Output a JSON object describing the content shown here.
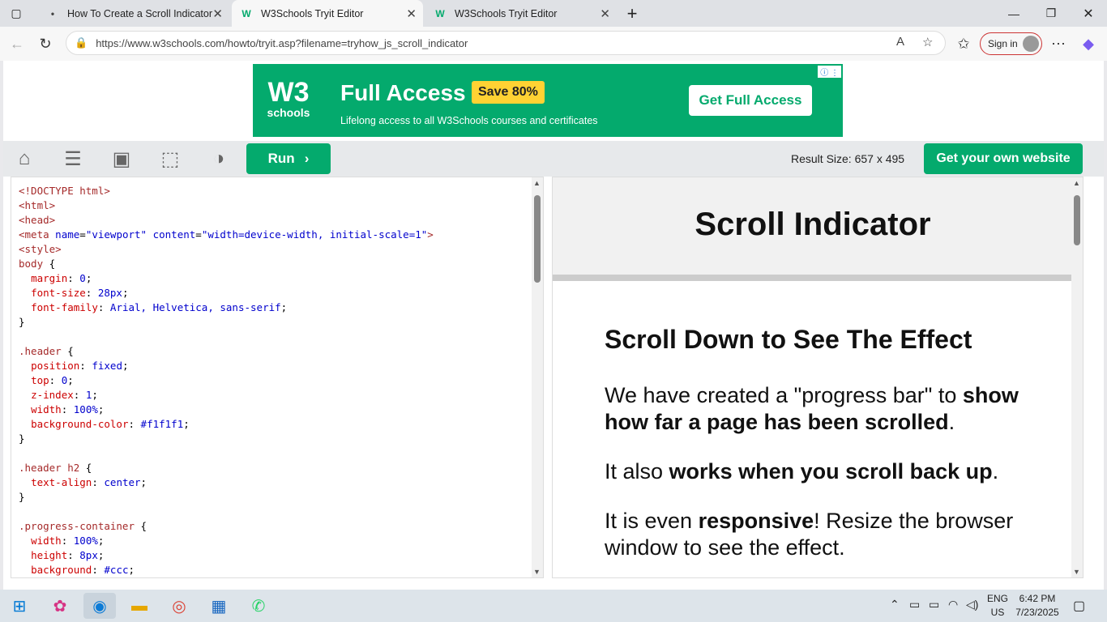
{
  "browser": {
    "tabs": [
      {
        "title": "How To Create a Scroll Indicator"
      },
      {
        "title": "W3Schools Tryit Editor"
      },
      {
        "title": "W3Schools Tryit Editor"
      }
    ],
    "url": "https://www.w3schools.com/howto/tryit.asp?filename=tryhow_js_scroll_indicator",
    "signin_label": "Sign in"
  },
  "ad": {
    "logo_text": "W3",
    "logo_sub": "schools",
    "title": "Full Access",
    "badge": "Save 80%",
    "subtitle": "Lifelong access to all W3Schools courses and certificates",
    "cta": "Get Full Access"
  },
  "toolbar": {
    "run_label": "Run",
    "result_size": "Result Size: 657 x 495",
    "get_website": "Get your own website"
  },
  "result": {
    "heading": "Scroll Indicator",
    "subheading": "Scroll Down to See The Effect",
    "p1_a": "We have created a \"progress bar\" to ",
    "p1_b": "show how far a page has been scrolled",
    "p1_c": ".",
    "p2_a": "It also ",
    "p2_b": "works when you scroll back up",
    "p2_c": ".",
    "p3_a": "It is even ",
    "p3_b": "responsive",
    "p3_c": "! Resize the browser window to see the effect."
  },
  "taskbar": {
    "lang_1": "ENG",
    "lang_2": "US",
    "time": "6:42 PM",
    "date": "7/23/2025"
  }
}
